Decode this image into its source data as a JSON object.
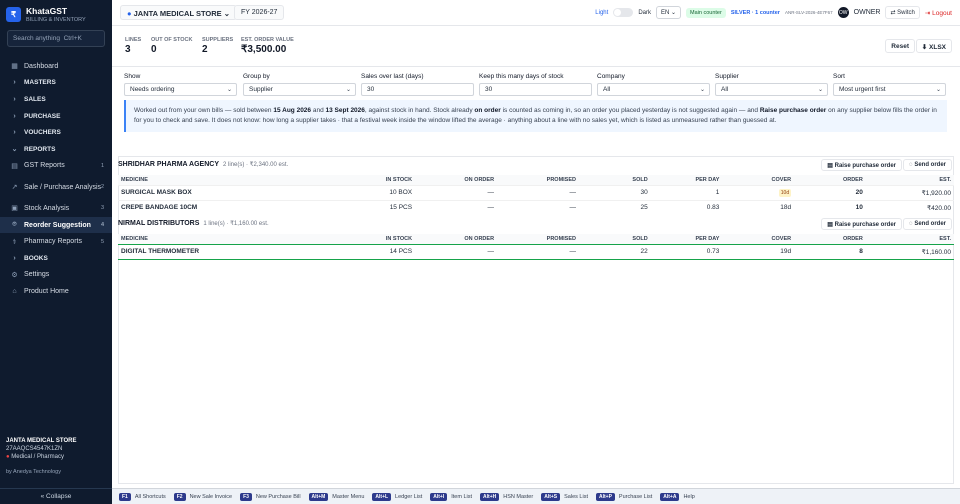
{
  "brand": {
    "name": "KhataGST",
    "tagline": "BILLING & INVENTORY",
    "logo": "₹"
  },
  "search": {
    "placeholder": "Search anything",
    "shortcut": "Ctrl+K"
  },
  "nav": [
    {
      "label": "Dashboard",
      "icon": "▦",
      "count": ""
    },
    {
      "label": "MASTERS",
      "icon": "›",
      "count": ""
    },
    {
      "label": "SALES",
      "icon": "›",
      "count": ""
    },
    {
      "label": "PURCHASE",
      "icon": "›",
      "count": ""
    },
    {
      "label": "VOUCHERS",
      "icon": "›",
      "count": ""
    },
    {
      "label": "REPORTS",
      "icon": "⌄",
      "count": ""
    },
    {
      "label": "GST Reports",
      "icon": "▤",
      "count": "1"
    },
    {
      "label": "Sale / Purchase Analysis",
      "icon": "↗",
      "count": "2"
    },
    {
      "label": "Stock Analysis",
      "icon": "▣",
      "count": "3"
    },
    {
      "label": "Reorder Suggestion",
      "icon": "⌾",
      "count": "4"
    },
    {
      "label": "Pharmacy Reports",
      "icon": "⚕",
      "count": "5"
    },
    {
      "label": "BOOKS",
      "icon": "›",
      "count": ""
    },
    {
      "label": "Settings",
      "icon": "⚙",
      "count": ""
    },
    {
      "label": "Product Home",
      "icon": "⌂",
      "count": ""
    }
  ],
  "sidebar_footer": {
    "store": "JANTA MEDICAL STORE",
    "gstin": "27AAQCS4547K1ZN",
    "category": "Medical / Pharmacy",
    "credit": "by Anedya Technology",
    "collapse": "« Collapse"
  },
  "header": {
    "store": "JANTA MEDICAL STORE",
    "fy": "FY 2026-27",
    "light": "Light",
    "dark": "Dark",
    "lang": "EN",
    "counter": "Main counter",
    "plan": "SILVER · 1 counter",
    "plan_id": "ANR-SLV-2026-4E7F67",
    "owner_initials": "OW",
    "owner": "OWNER",
    "switch": "⇄ Switch",
    "logout": "⇥ Logout"
  },
  "summary": {
    "lines_label": "LINES",
    "lines": "3",
    "oos_label": "OUT OF STOCK",
    "oos": "0",
    "suppliers_label": "SUPPLIERS",
    "suppliers": "2",
    "value_label": "EST. ORDER VALUE",
    "value": "₹3,500.00",
    "reset": "Reset",
    "xlsx": "⬇ XLSX"
  },
  "filters": [
    {
      "label": "Show",
      "value": "Needs ordering",
      "select": true
    },
    {
      "label": "Group by",
      "value": "Supplier",
      "select": true
    },
    {
      "label": "Sales over last (days)",
      "value": "30",
      "select": false
    },
    {
      "label": "Keep this many days of stock",
      "value": "30",
      "select": false
    },
    {
      "label": "Company",
      "value": "All",
      "select": true
    },
    {
      "label": "Supplier",
      "value": "All",
      "select": true
    },
    {
      "label": "Sort",
      "value": "Most urgent first",
      "select": true
    }
  ],
  "info": {
    "p1": "Worked out from your own bills — sold between ",
    "d1": "15 Aug 2026",
    "p2": " and ",
    "d2": "13 Sept 2026",
    "p3": ", against stock in hand. Stock already ",
    "b1": "on order",
    "p4": " is counted as coming in, so an order you placed yesterday is not suggested again — and ",
    "b2": "Raise purchase order",
    "p5": " on any supplier below fills the order in for you to check and save. It does not know: how long a supplier takes · that a festival week inside the window lifted the average · anything about a line with no sales yet, which is listed as unmeasured rather than guessed at."
  },
  "columns": [
    "MEDICINE",
    "IN STOCK",
    "ON ORDER",
    "PROMISED",
    "SOLD",
    "PER DAY",
    "COVER",
    "ORDER",
    "EST."
  ],
  "buttons": {
    "raise": "Raise purchase order",
    "send": "Send order"
  },
  "suppliers": [
    {
      "name": "SHRIDHAR PHARMA AGENCY",
      "meta": "2 line(s) · ₹2,340.00 est.",
      "rows": [
        {
          "medicine": "SURGICAL MASK BOX",
          "in_stock": "10 BOX",
          "on_order": "—",
          "promised": "—",
          "sold": "30",
          "per_day": "1",
          "cover": "10d",
          "order": "20",
          "est": "₹1,920.00"
        },
        {
          "medicine": "CREPE BANDAGE 10CM",
          "in_stock": "15 PCS",
          "on_order": "—",
          "promised": "—",
          "sold": "25",
          "per_day": "0.83",
          "cover": "18d",
          "order": "10",
          "est": "₹420.00"
        }
      ]
    },
    {
      "name": "NIRMAL DISTRIBUTORS",
      "meta": "1 line(s) · ₹1,160.00 est.",
      "rows": [
        {
          "medicine": "DIGITAL THERMOMETER",
          "in_stock": "14 PCS",
          "on_order": "—",
          "promised": "—",
          "sold": "22",
          "per_day": "0.73",
          "cover": "19d",
          "order": "8",
          "est": "₹1,160.00"
        }
      ]
    }
  ],
  "shortcuts": [
    {
      "key": "F1",
      "label": "All Shortcuts"
    },
    {
      "key": "F2",
      "label": "New Sale Invoice"
    },
    {
      "key": "F3",
      "label": "New Purchase Bill"
    },
    {
      "key": "Alt+M",
      "label": "Master Menu"
    },
    {
      "key": "Alt+L",
      "label": "Ledger List"
    },
    {
      "key": "Alt+I",
      "label": "Item List"
    },
    {
      "key": "Alt+H",
      "label": "HSN Master"
    },
    {
      "key": "Alt+S",
      "label": "Sales List"
    },
    {
      "key": "Alt+P",
      "label": "Purchase List"
    },
    {
      "key": "Alt+A",
      "label": "Help"
    }
  ]
}
